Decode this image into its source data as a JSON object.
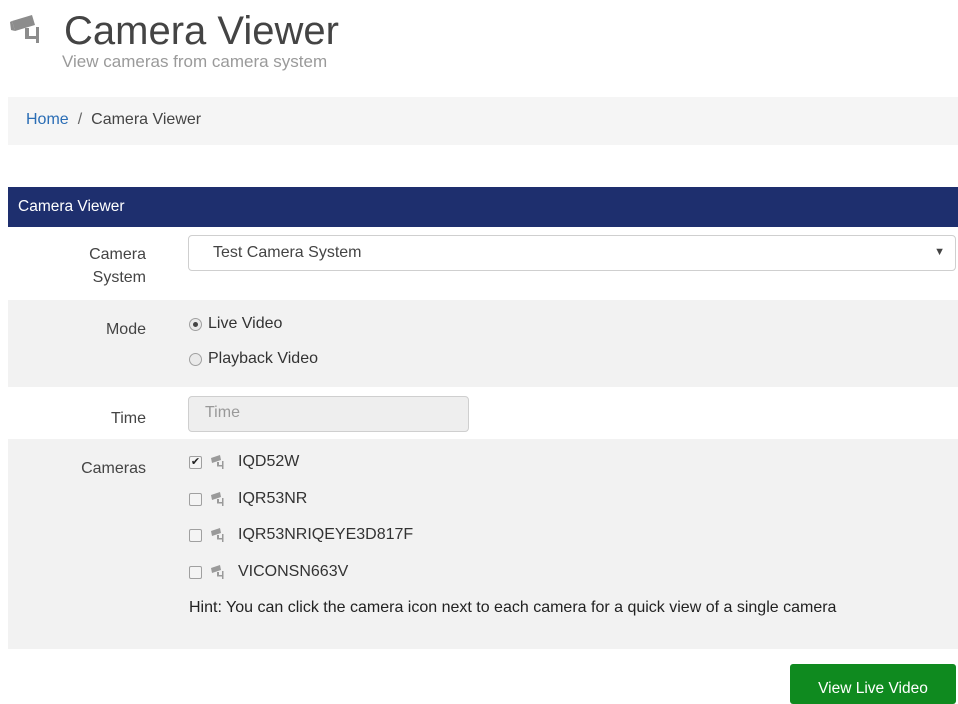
{
  "header": {
    "title": "Camera Viewer",
    "subtitle": "View cameras from camera system",
    "icon": "cctv-camera-icon"
  },
  "breadcrumb": {
    "home": "Home",
    "separator": "/",
    "current": "Camera Viewer"
  },
  "panel": {
    "heading": "Camera Viewer",
    "heading_color": "#1e2f6e",
    "camera_system": {
      "label_line1": "Camera",
      "label_line2": "System",
      "selected": "Test Camera System"
    },
    "mode": {
      "label": "Mode",
      "options": [
        {
          "label": "Live Video",
          "selected": true
        },
        {
          "label": "Playback Video",
          "selected": false
        }
      ]
    },
    "time": {
      "label": "Time",
      "placeholder": "Time"
    },
    "cameras": {
      "label": "Cameras",
      "items": [
        {
          "name": "IQD52W",
          "checked": true
        },
        {
          "name": "IQR53NR",
          "checked": false
        },
        {
          "name": "IQR53NRIQEYE3D817F",
          "checked": false
        },
        {
          "name": "VICONSN663V",
          "checked": false
        }
      ],
      "hint": "Hint: You can click the camera icon next to each camera for a quick view of a single camera"
    }
  },
  "actions": {
    "view_button": "View Live Video",
    "button_color": "#0f8a1f"
  }
}
